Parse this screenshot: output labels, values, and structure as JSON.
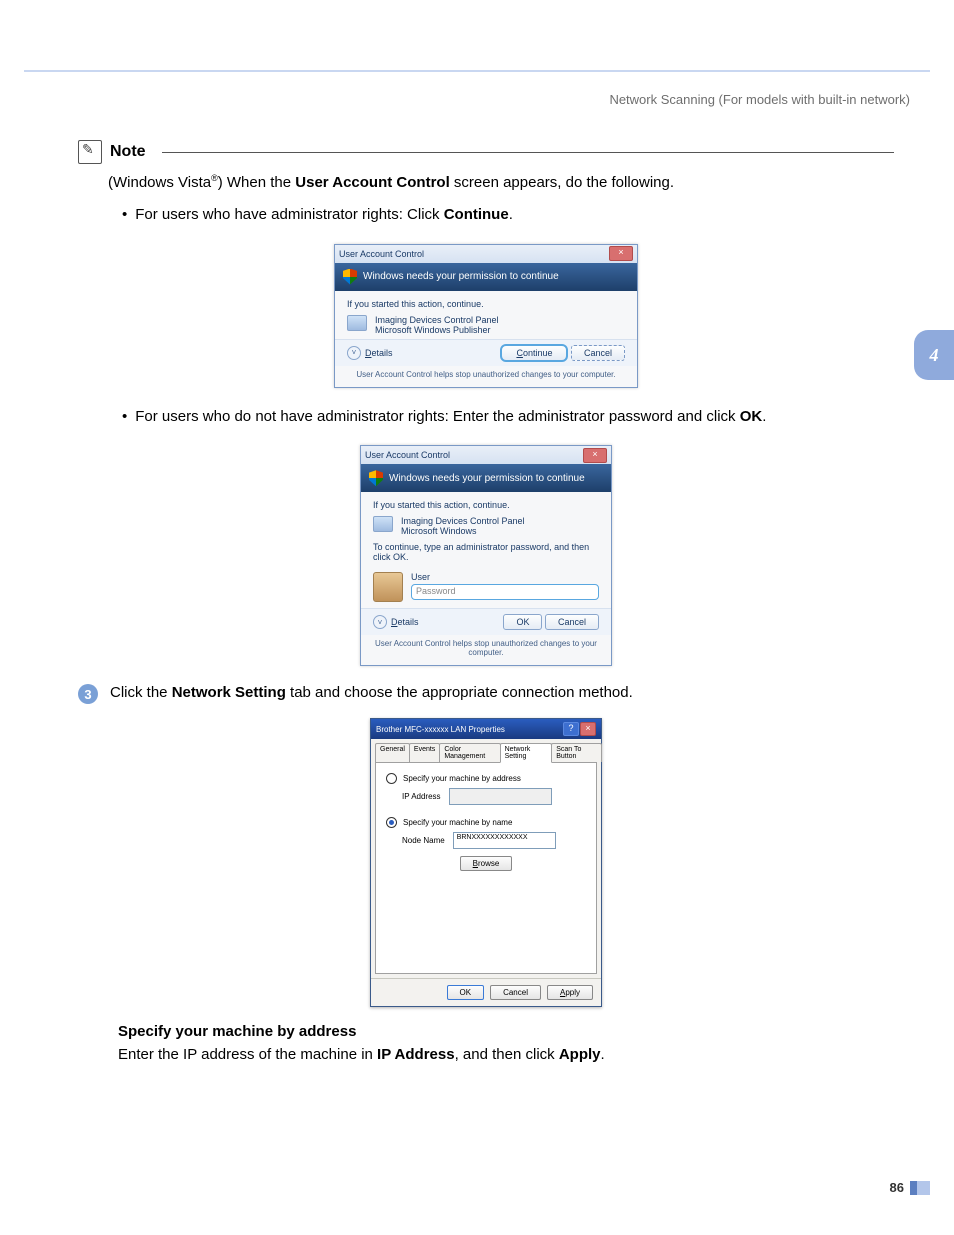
{
  "header": "Network Scanning (For models with built-in network)",
  "chapter_number": "4",
  "note_label": "Note",
  "note": {
    "intro_pre": "(Windows Vista",
    "intro_post": ") When the ",
    "intro_bold": "User Account Control",
    "intro_end": " screen appears, do the following.",
    "bullet1_pre": "For users who have administrator rights: Click ",
    "bullet1_bold": "Continue",
    "bullet1_end": ".",
    "bullet2_pre": "For users who do not have administrator rights: Enter the administrator password and click ",
    "bullet2_bold": "OK",
    "bullet2_end": "."
  },
  "uac1": {
    "title": "User Account Control",
    "banner": "Windows needs your permission to continue",
    "if_started": "If you started this action, continue.",
    "prog1": "Imaging Devices Control Panel",
    "prog2": "Microsoft Windows Publisher",
    "details": "Details",
    "continue": "Continue",
    "cancel": "Cancel",
    "footnote": "User Account Control helps stop unauthorized changes to your computer."
  },
  "uac2": {
    "title": "User Account Control",
    "banner": "Windows needs your permission to continue",
    "if_started": "If you started this action, continue.",
    "prog1": "Imaging Devices Control Panel",
    "prog2": "Microsoft Windows",
    "instruct": "To continue, type an administrator password, and then click OK.",
    "user": "User",
    "password_ph": "Password",
    "details": "Details",
    "ok": "OK",
    "cancel": "Cancel",
    "footnote": "User Account Control helps stop unauthorized changes to your computer."
  },
  "step3": {
    "num": "3",
    "pre": "Click the ",
    "bold": "Network Setting",
    "post": " tab and choose the appropriate connection method."
  },
  "props": {
    "title": "Brother MFC-xxxxxx  LAN Properties",
    "tabs": {
      "general": "General",
      "events": "Events",
      "color": "Color Management",
      "network": "Network Setting",
      "scan": "Scan To Button"
    },
    "radio1": "Specify your machine by address",
    "ip_label": "IP Address",
    "radio2": "Specify your machine by name",
    "node_label": "Node Name",
    "node_value": "BRNXXXXXXXXXXXX",
    "browse": "Browse",
    "ok": "OK",
    "cancel": "Cancel",
    "apply": "Apply"
  },
  "section": {
    "heading": "Specify your machine by address",
    "text_pre": "Enter the IP address of the machine in ",
    "text_b1": "IP Address",
    "text_mid": ", and then click ",
    "text_b2": "Apply",
    "text_end": "."
  },
  "page_number": "86"
}
